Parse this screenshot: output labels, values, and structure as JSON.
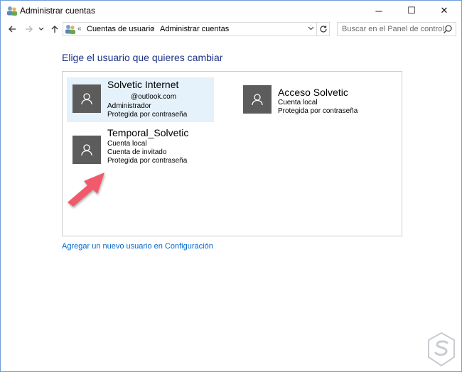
{
  "window": {
    "title": "Administrar cuentas",
    "controls": {
      "minimize": "─",
      "maximize": "☐",
      "close": "✕"
    }
  },
  "navigation": {
    "back_icon": "arrow-left-icon",
    "forward_icon": "arrow-right-icon",
    "up_icon": "arrow-up-icon",
    "overflow": "«",
    "breadcrumbs": [
      "Cuentas de usuario",
      "Administrar cuentas"
    ],
    "separator": "›",
    "search_placeholder": "Buscar en el Panel de control"
  },
  "main": {
    "heading": "Elige el usuario que quieres cambiar",
    "accounts": [
      {
        "name": "Solvetic Internet",
        "lines": [
          "@outlook.com",
          "Administrador",
          "Protegida por contraseña"
        ],
        "selected": true
      },
      {
        "name": "Acceso Solvetic",
        "lines": [
          "Cuenta local",
          "Protegida por contraseña"
        ],
        "selected": false
      },
      {
        "name": "Temporal_Solvetic",
        "lines": [
          "Cuenta local",
          "Cuenta de invitado",
          "Protegida por contraseña"
        ],
        "selected": false
      }
    ],
    "add_user_link": "Agregar un nuevo usuario en Configuración"
  },
  "colors": {
    "heading": "#1e3287",
    "link": "#0066cc",
    "selected_bg": "#e5f1fb",
    "avatar_bg": "#5c5c5c",
    "arrow": "#f05a6b",
    "window_border": "#6f9dd9"
  }
}
